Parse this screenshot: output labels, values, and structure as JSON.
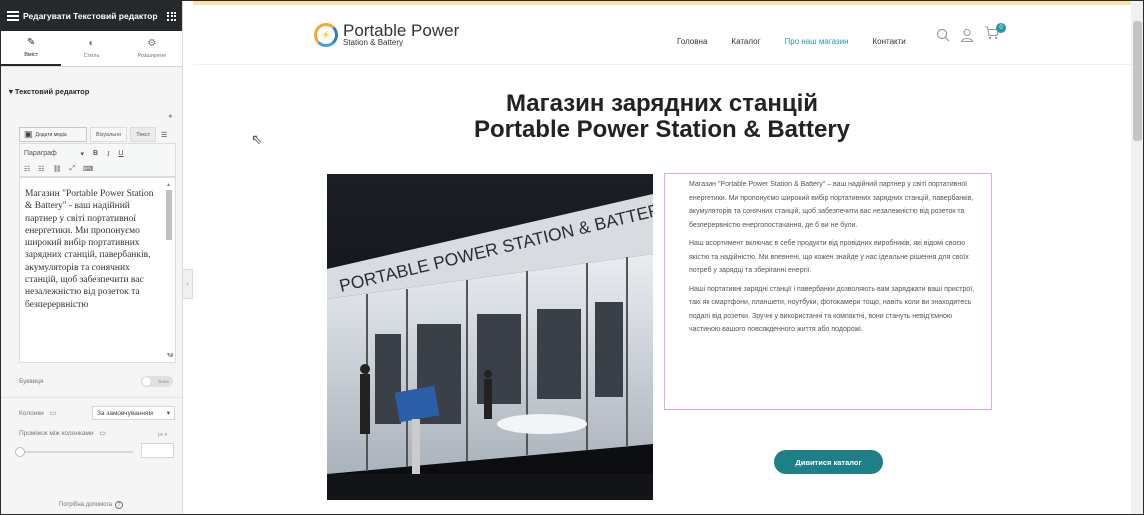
{
  "editor": {
    "title": "Редагувати Текстовий редактор",
    "tabs": [
      {
        "label": "Вміст",
        "icon": "pencil-icon"
      },
      {
        "label": "Стиль",
        "icon": "half-circle-icon"
      },
      {
        "label": "Розширене",
        "icon": "gear-icon"
      }
    ],
    "section_title": "Текстовий редактор",
    "add_media_label": "Додати медіа",
    "view_tabs": [
      "Візуально",
      "Текст"
    ],
    "format_select": "Параграф",
    "toolbar_bold": "B",
    "toolbar_italic": "I",
    "toolbar_underline": "U",
    "content": "Магазин \"Portable Power Station & Battery\" - ваш надійний партнер у світі портативної енергетики. Ми пропонуємо широкий вибір портативних зарядних станцій, павербанків, акумуляторів та сонячних станцій, щоб забезпечити вас незалежністю від розеток та безперервністю",
    "dropcap_label": "Буквиця",
    "dropcap_toggle": "Вимк",
    "columns_label": "Колонки",
    "columns_value": "За замовчуванням",
    "gap_label": "Проміжок між колонками",
    "gap_unit": "px",
    "help_label": "Потрібна допомога"
  },
  "site": {
    "logo_line1": "Portable Power",
    "logo_line2": "Station & Battery",
    "nav": [
      "Головна",
      "Каталог",
      "Про наш магазин",
      "Контакти"
    ],
    "cart_count": "0",
    "heading_line1": "Магазин зарядних станцій",
    "heading_line2": "Portable Power Station & Battery",
    "photo_sign": "PORTABLE POWER STATION & BATTERY",
    "paragraphs": [
      "Магазин \"Portable Power Station & Battery\" – ваш надійний партнер у світі портативної енергетики. Ми пропонуємо широкий вибір портативних зарядних станцій, павербанків, акумуляторів та сонячних станцій, щоб забезпечити вас незалежністю від розеток та безперервністю енергопостачання, де б ви не були.",
      "Наш асортимент включає в себе продукти від провідних виробників, які відомі своєю якістю та надійністю. Ми впевнені, що кожен знайде у нас ідеальне рішення для своїх потреб у зарядці та зберіганні енергії.",
      "Наші портативні зарядні станції і павербанки дозволяють вам заряджати ваші пристрої, такі як смартфони, планшети, ноутбуки, фотокамери тощо, навіть коли ви знаходитесь подалі від розетки. Зручні у використанні та компактні, вони стануть невід'ємною частиною вашого повсякденного життя або подорожі."
    ],
    "cta_label": "Дивитися каталог"
  },
  "colors": {
    "accent": "#1f9aa6",
    "cta": "#1f7f89",
    "editor_dark": "#26292c",
    "selection_border": "#e2a8e8"
  }
}
